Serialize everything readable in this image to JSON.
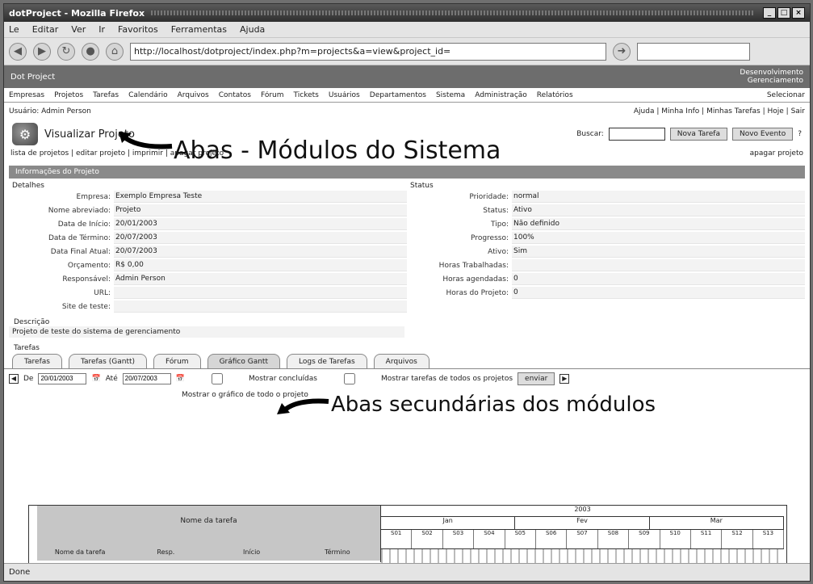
{
  "window": {
    "title": "dotProject - Mozilla Firefox"
  },
  "menubar": [
    "Le",
    "Editar",
    "Ver",
    "Ir",
    "Favoritos",
    "Ferramentas",
    "Ajuda"
  ],
  "navigation": {
    "url": "http://localhost/dotproject/index.php?m=projects&a=view&project_id=",
    "search_placeholder": ""
  },
  "app_header": {
    "left": "Dot Project",
    "right_line1": "Desenvolvimento",
    "right_line2": "Gerenciamento"
  },
  "modules": {
    "tabs": [
      "Empresas",
      "Projetos",
      "Tarefas",
      "Calendário",
      "Arquivos",
      "Contatos",
      "Fórum",
      "Tickets",
      "Usuários",
      "Departamentos",
      "Sistema",
      "Administração",
      "Relatórios"
    ],
    "right_select": "Selecionar"
  },
  "user_bar": {
    "left": "Usuário: Admin Person",
    "right": "Ajuda | Minha Info | Minhas Tarefas | Hoje | Sair"
  },
  "page": {
    "title": "Visualizar Projeto",
    "search_label": "Buscar:",
    "btn1": "Nova Tarefa",
    "btn2": "Novo Evento",
    "actions_left": "lista de projetos | editar projeto | imprimir | apagar projeto",
    "actions_right": "apagar projeto"
  },
  "section_header": "Informações do Projeto",
  "details_left": {
    "heading": "Detalhes",
    "rows": [
      {
        "label": "Empresa:",
        "value": "Exemplo Empresa Teste"
      },
      {
        "label": "Nome abreviado:",
        "value": "Projeto"
      },
      {
        "label": "Data de Início:",
        "value": "20/01/2003"
      },
      {
        "label": "Data de Término:",
        "value": "20/07/2003"
      },
      {
        "label": "Data Final Atual:",
        "value": "20/07/2003"
      },
      {
        "label": "Orçamento:",
        "value": "R$ 0,00"
      },
      {
        "label": "Responsável:",
        "value": "Admin Person"
      },
      {
        "label": "URL:",
        "value": ""
      },
      {
        "label": "Site de teste:",
        "value": ""
      }
    ]
  },
  "details_right": {
    "heading": "Status",
    "rows": [
      {
        "label": "Prioridade:",
        "value": "normal"
      },
      {
        "label": "Status:",
        "value": "Ativo"
      },
      {
        "label": "Tipo:",
        "value": "Não definido"
      },
      {
        "label": "Progresso:",
        "value": "100%"
      },
      {
        "label": "Ativo:",
        "value": "Sim"
      },
      {
        "label": "Horas Trabalhadas:",
        "value": ""
      },
      {
        "label": "Horas agendadas:",
        "value": "0"
      },
      {
        "label": "Horas do Projeto:",
        "value": "0"
      }
    ]
  },
  "description": {
    "label": "Descrição",
    "value": "Projeto de teste do sistema de gerenciamento"
  },
  "notes_label": "Tarefas",
  "subtabs": [
    "Tarefas",
    "Tarefas (Gantt)",
    "Fórum",
    "Gráfico Gantt",
    "Logs de Tarefas",
    "Arquivos"
  ],
  "active_subtab": 3,
  "filter": {
    "from_label": "De",
    "from_value": "20/01/2003",
    "to_label": "Até",
    "to_value": "20/07/2003",
    "check1": "Mostrar concluídas",
    "check2": "Mostrar tarefas de todos os projetos",
    "submit": "enviar",
    "line2": "Mostrar o gráfico de todo o projeto"
  },
  "gantt": {
    "head": "Nome da tarefa",
    "cols": [
      "Nome da tarefa",
      "Resp.",
      "Início",
      "Término"
    ],
    "year": "2003",
    "months": [
      "Jan",
      "Fev",
      "Mar"
    ],
    "weeks": [
      "S01",
      "S02",
      "S03",
      "S04",
      "S05",
      "S06",
      "S07",
      "S08",
      "S09",
      "S10",
      "S11",
      "S12",
      "S13"
    ]
  },
  "annotations": {
    "a1": "Abas - Módulos do Sistema",
    "a2": "Abas secundárias dos módulos"
  },
  "statusbar": "Done"
}
